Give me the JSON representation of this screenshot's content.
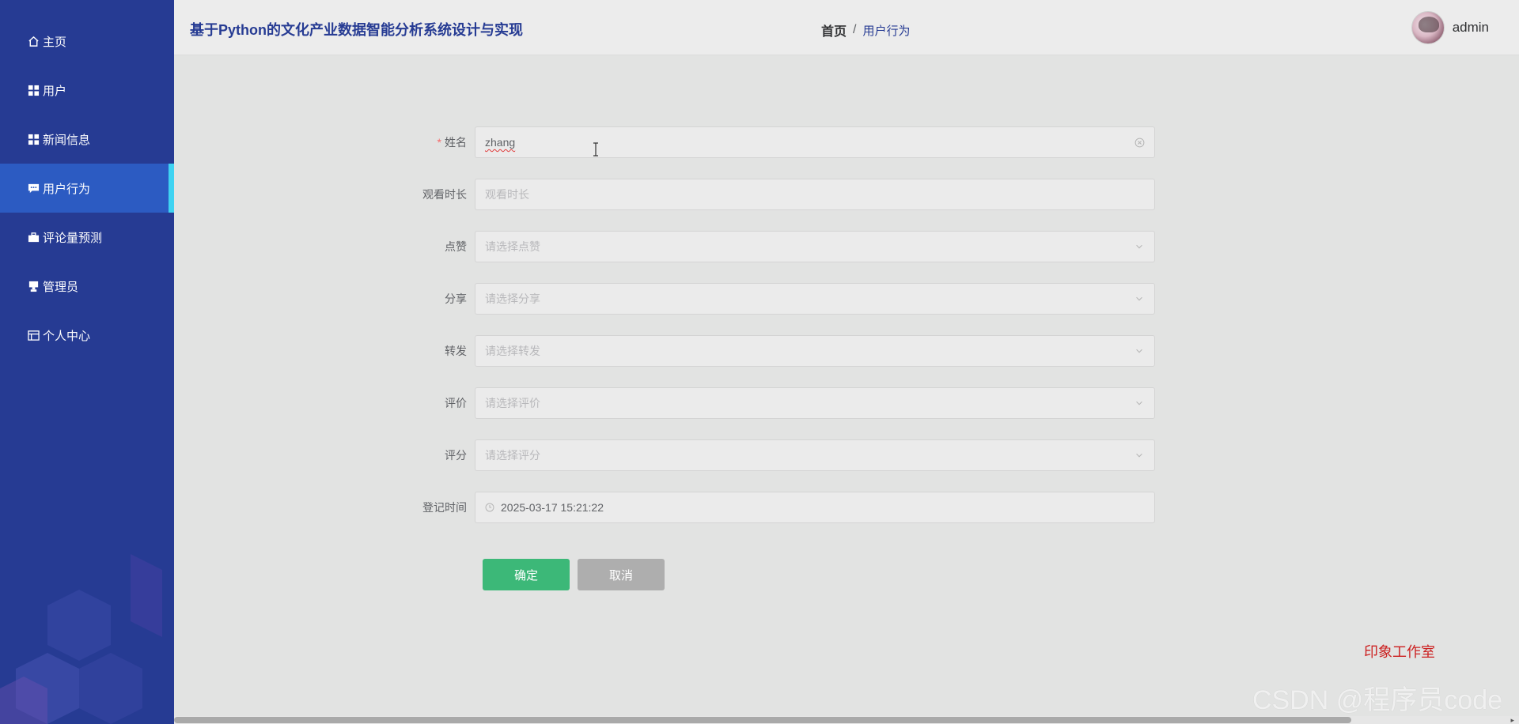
{
  "app": {
    "title": "基于Python的文化产业数据智能分析系统设计与实现"
  },
  "breadcrumb": {
    "home": "首页",
    "separator": "/",
    "current": "用户行为"
  },
  "user": {
    "name": "admin"
  },
  "sidebar": {
    "items": [
      {
        "label": "主页",
        "icon": "home-icon"
      },
      {
        "label": "用户",
        "icon": "grid-icon"
      },
      {
        "label": "新闻信息",
        "icon": "grid-icon"
      },
      {
        "label": "用户行为",
        "icon": "chat-icon",
        "active": true
      },
      {
        "label": "评论量预测",
        "icon": "briefcase-icon"
      },
      {
        "label": "管理员",
        "icon": "stamp-icon"
      },
      {
        "label": "个人中心",
        "icon": "window-icon"
      }
    ]
  },
  "form": {
    "name": {
      "label": "姓名",
      "required_mark": "*",
      "value": "zhang"
    },
    "watch_time": {
      "label": "观看时长",
      "placeholder": "观看时长"
    },
    "like": {
      "label": "点赞",
      "placeholder": "请选择点赞"
    },
    "share": {
      "label": "分享",
      "placeholder": "请选择分享"
    },
    "forward": {
      "label": "转发",
      "placeholder": "请选择转发"
    },
    "review": {
      "label": "评价",
      "placeholder": "请选择评价"
    },
    "score": {
      "label": "评分",
      "placeholder": "请选择评分"
    },
    "register_time": {
      "label": "登记时间",
      "value": "2025-03-17 15:21:22"
    }
  },
  "buttons": {
    "confirm": "确定",
    "cancel": "取消"
  },
  "footer": {
    "studio": "印象工作室",
    "watermark": "CSDN @程序员code"
  },
  "colors": {
    "sidebar": "#263b93",
    "active_item": "#2c5bc2",
    "active_indicator": "#3fd3f2",
    "confirm": "#3cb878",
    "cancel": "#aeaeae",
    "studio_text": "#cc2020"
  }
}
